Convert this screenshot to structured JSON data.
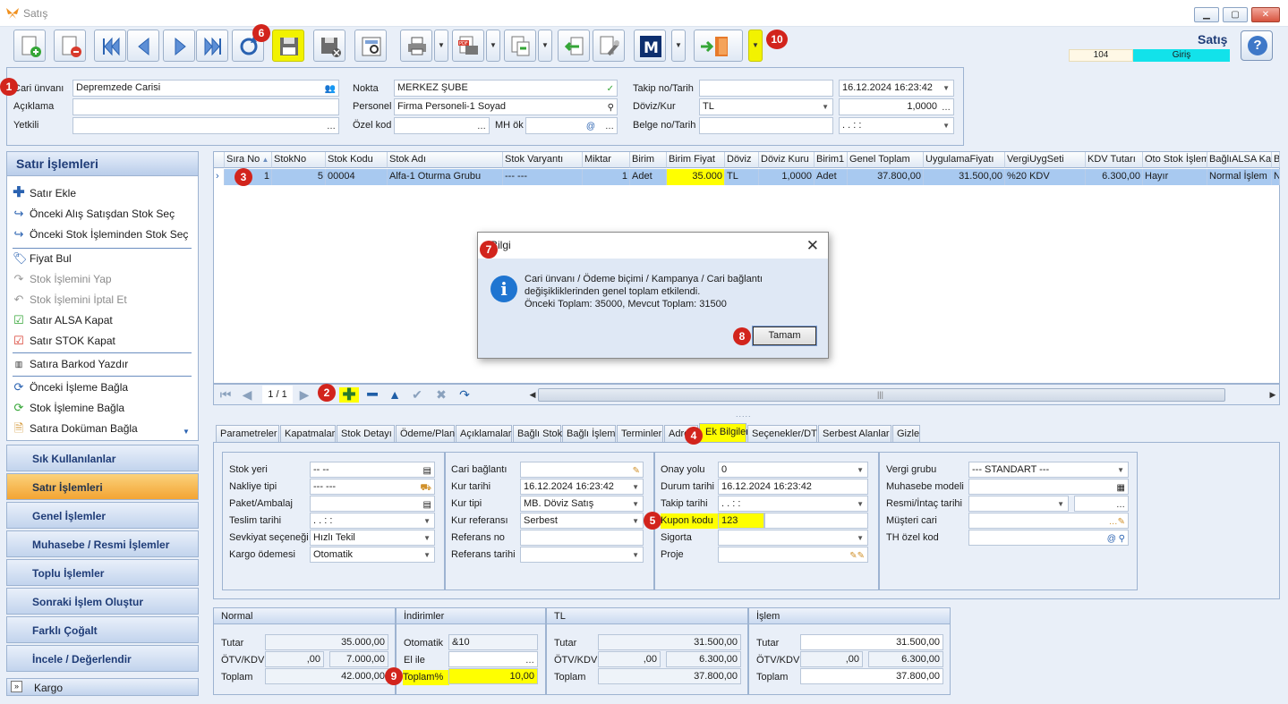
{
  "window": {
    "title": "Satış"
  },
  "header": {
    "screen_title": "Satış",
    "doc_no": "104",
    "mode": "Giriş",
    "fields": {
      "cari_unvani_label": "Cari ünvanı",
      "cari_unvani": "Depremzede Carisi",
      "aciklama_label": "Açıklama",
      "aciklama": "",
      "yetkili_label": "Yetkili",
      "yetkili": "",
      "nokta_label": "Nokta",
      "nokta": "MERKEZ ŞUBE",
      "personel_label": "Personel",
      "personel": "Firma Personeli-1 Soyad",
      "ozel_kod_label": "Özel kod",
      "ozel_kod": "",
      "mh_ok_label": "MH ök",
      "mh_ok": "",
      "takip_label": "Takip no/Tarih",
      "takip_no": "",
      "takip_tarih": "16.12.2024 16:23:42",
      "doviz_label": "Döviz/Kur",
      "doviz": "TL",
      "kur": "1,0000",
      "belge_label": "Belge no/Tarih",
      "belge_no": "",
      "belge_tarih": ". .   : :"
    }
  },
  "sidebar": {
    "title": "Satır İşlemleri",
    "items": [
      {
        "label": "Satır Ekle"
      },
      {
        "label": "Önceki Alış Satışdan Stok Seç"
      },
      {
        "label": "Önceki Stok İşleminden Stok Seç"
      },
      {
        "label": "Fiyat Bul"
      },
      {
        "label": "Stok İşlemini Yap"
      },
      {
        "label": "Stok İşlemini İptal Et"
      },
      {
        "label": "Satır ALSA Kapat"
      },
      {
        "label": "Satır STOK Kapat"
      },
      {
        "label": "Satıra Barkod Yazdır"
      },
      {
        "label": "Önceki İşleme Bağla"
      },
      {
        "label": "Stok İşlemine Bağla"
      },
      {
        "label": "Satıra Doküman Bağla"
      }
    ],
    "nav": [
      {
        "label": "Sık Kullanılanlar"
      },
      {
        "label": "Satır İşlemleri"
      },
      {
        "label": "Genel İşlemler"
      },
      {
        "label": "Muhasebe / Resmi İşlemler"
      },
      {
        "label": "Toplu İşlemler"
      },
      {
        "label": "Sonraki İşlem Oluştur"
      },
      {
        "label": "Farklı Çoğalt"
      },
      {
        "label": "İncele / Değerlendir"
      },
      {
        "label": "Kargo"
      }
    ]
  },
  "grid": {
    "columns": [
      "Sıra No",
      "StokNo",
      "Stok Kodu",
      "Stok Adı",
      "Stok Varyantı",
      "Miktar",
      "Birim",
      "Birim Fiyat",
      "Döviz",
      "Döviz Kuru",
      "Birim1",
      "Genel Toplam",
      "UygulamaFiyatı",
      "VergiUygSeti",
      "KDV Tutarı",
      "Oto Stok İşlem",
      "BağlıALSA Kap",
      "B"
    ],
    "row": [
      "1",
      "5",
      "00004",
      "Alfa-1 Oturma Grubu",
      "--- ---",
      "1",
      "Adet",
      "35.000",
      "TL",
      "1,0000",
      "Adet",
      "37.800,00",
      "31.500,00",
      "%20 KDV",
      "6.300,00",
      "Hayır",
      "Normal İşlem",
      "N"
    ],
    "pager": "1 / 1"
  },
  "tabs": [
    "Parametreler",
    "Kapatmalar",
    "Stok Detayı",
    "Ödeme/Plan",
    "Açıklamalar",
    "Bağlı Stok",
    "Bağlı İşlem",
    "Terminler",
    "Adres",
    "Ek Bilgiler",
    "Seçenekler/DT",
    "Serbest Alanlar",
    "Gizle"
  ],
  "ek_bilgiler": {
    "g1": [
      {
        "label": "Stok yeri",
        "value": "-- --"
      },
      {
        "label": "Nakliye tipi",
        "value": "--- ---"
      },
      {
        "label": "Paket/Ambalaj",
        "value": ""
      },
      {
        "label": "Teslim tarihi",
        "value": ". .   : :"
      },
      {
        "label": "Sevkiyat seçeneği",
        "value": "Hızlı Tekil"
      },
      {
        "label": "Kargo ödemesi",
        "value": "Otomatik"
      }
    ],
    "g2": [
      {
        "label": "Cari bağlantı",
        "value": ""
      },
      {
        "label": "Kur tarihi",
        "value": "16.12.2024 16:23:42"
      },
      {
        "label": "Kur tipi",
        "value": "MB. Döviz Satış"
      },
      {
        "label": "Kur referansı",
        "value": "Serbest"
      },
      {
        "label": "Referans no",
        "value": ""
      },
      {
        "label": "Referans tarihi",
        "value": ""
      }
    ],
    "g3": [
      {
        "label": "Onay yolu",
        "value": "0"
      },
      {
        "label": "Durum tarihi",
        "value": "16.12.2024 16:23:42"
      },
      {
        "label": "Takip tarihi",
        "value": ". .   : :"
      },
      {
        "label": "Kupon kodu",
        "value": "123"
      },
      {
        "label": "Sigorta",
        "value": ""
      },
      {
        "label": "Proje",
        "value": ""
      }
    ],
    "g4": [
      {
        "label": "Vergi grubu",
        "value": "--- STANDART ---"
      },
      {
        "label": "Muhasebe modeli",
        "value": ""
      },
      {
        "label": "Resmi/İntaç tarihi",
        "value": ""
      },
      {
        "label": "Müşteri cari",
        "value": ""
      },
      {
        "label": "TH özel kod",
        "value": ""
      }
    ]
  },
  "totals": {
    "normal": {
      "title": "Normal",
      "tutar_label": "Tutar",
      "tutar": "35.000,00",
      "otv_label": "ÖTV/KDV",
      "otv": ",00",
      "kdv": "7.000,00",
      "toplam_label": "Toplam",
      "toplam": "42.000,00"
    },
    "indirim": {
      "title": "İndirimler",
      "otomatik_label": "Otomatik",
      "otomatik": "&10",
      "elile_label": "El ile",
      "elile": "",
      "toplam_label": "Toplam%",
      "toplam": "10,00"
    },
    "tl": {
      "title": "TL",
      "tutar_label": "Tutar",
      "tutar": "31.500,00",
      "otv_label": "ÖTV/KDV",
      "otv": ",00",
      "kdv": "6.300,00",
      "toplam_label": "Toplam",
      "toplam": "37.800,00"
    },
    "islem": {
      "title": "İşlem",
      "tutar_label": "Tutar",
      "tutar": "31.500,00",
      "otv_label": "ÖTV/KDV",
      "otv": ",00",
      "kdv": "6.300,00",
      "toplam_label": "Toplam",
      "toplam": "37.800,00"
    }
  },
  "dialog": {
    "title": "Bilgi",
    "line1": "Cari ünvanı / Ödeme biçimi / Kampanya / Cari bağlantı",
    "line2": "değişikliklerinden genel toplam etkilendi.",
    "line3": "Önceki Toplam: 35000, Mevcut Toplam: 31500",
    "ok": "Tamam"
  },
  "badges": [
    "1",
    "2",
    "3",
    "4",
    "5",
    "6",
    "7",
    "8",
    "9",
    "10"
  ],
  "colors": {
    "highlight": "#ffff00",
    "badge": "#d2241c",
    "accent": "#1f3c77",
    "selected_row": "#a8c9f0"
  }
}
